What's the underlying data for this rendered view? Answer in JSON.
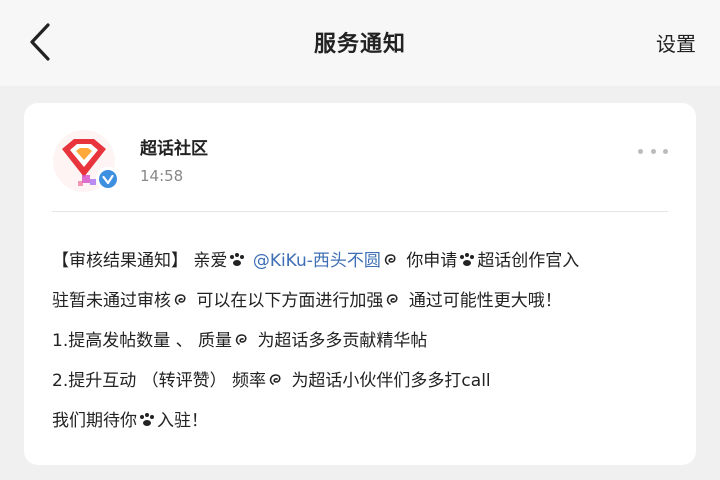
{
  "header": {
    "title": "服务通知",
    "settings_label": "设置",
    "back_icon": "chevron-left-icon"
  },
  "message": {
    "sender": "超话社区",
    "time": "14:58",
    "avatar_icon": "super-topic-diamond-logo",
    "verified_icon": "verified-check-icon",
    "more_icon": "more-dots-icon",
    "lines": {
      "l1_a": "【审核结果通知】 亲爱",
      "l1_mention": "@KiKu-西头不圆",
      "l1_b": "你申请",
      "l1_c": "超话创作官入",
      "l2_a": "驻暂未通过审核",
      "l2_b": "可以在以下方面进行加强",
      "l2_c": "通过可能性更大哦！",
      "l3_a": "1.提高发帖数量 、 质量",
      "l3_b": "为超话多多贡献精华帖",
      "l4_a": "2.提升互动 （转评赞） 频率",
      "l4_b": "为超话小伙伴们多多打call",
      "l5_a": "我们期待你",
      "l5_b": "入驻！"
    },
    "emojis": [
      "paw-icon",
      "swirl-icon"
    ]
  },
  "colors": {
    "mention": "#3f6fb5",
    "background": "#f0f0f0",
    "card": "#ffffff",
    "logo_red": "#e8343c",
    "verified_blue": "#3d8fe0"
  }
}
